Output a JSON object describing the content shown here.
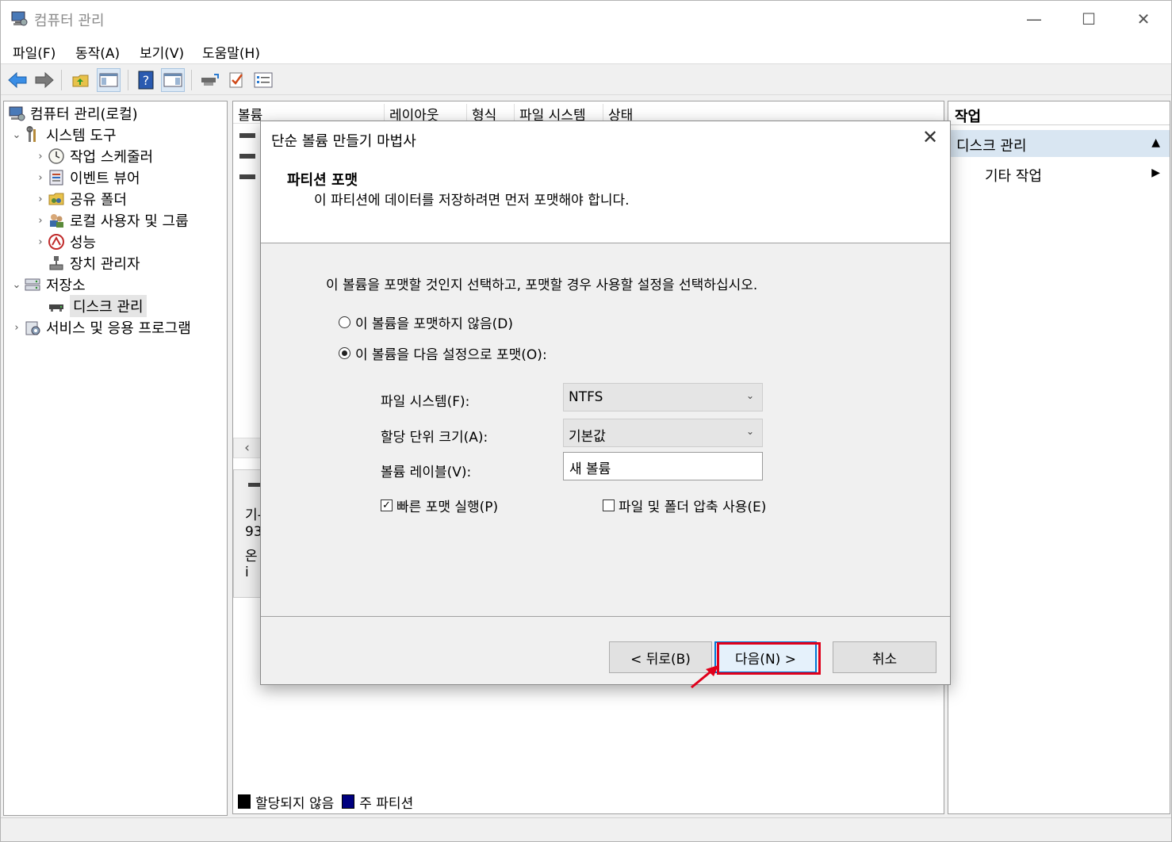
{
  "window": {
    "title": "컴퓨터 관리",
    "minimize_glyph": "—",
    "maximize_glyph": "☐",
    "close_glyph": "✕"
  },
  "menu": [
    "파일(F)",
    "동작(A)",
    "보기(V)",
    "도움말(H)"
  ],
  "toolbar_icons": [
    "back-arrow-icon",
    "forward-arrow-icon",
    "up-folder-icon",
    "show-hide-console-tree-icon",
    "help-icon",
    "show-hide-action-pane-icon",
    "connect-icon",
    "check-icon",
    "properties-list-icon"
  ],
  "tree": {
    "root": "컴퓨터 관리(로컬)",
    "system_tools": "시스템 도구",
    "task_scheduler": "작업 스케줄러",
    "event_viewer": "이벤트 뷰어",
    "shared_folders": "공유 폴더",
    "local_users": "로컬 사용자 및 그룹",
    "performance": "성능",
    "device_manager": "장치 관리자",
    "storage": "저장소",
    "disk_management": "디스크 관리",
    "services_apps": "서비스 및 응용 프로그램",
    "expand_glyph": "›",
    "collapse_glyph": "⌄"
  },
  "center": {
    "columns": [
      "볼륨",
      "레이아웃",
      "형식",
      "파일 시스템",
      "상태"
    ],
    "disk_info_fragments": [
      "기-",
      "93",
      "온i"
    ],
    "scroll_left_glyph": "‹",
    "legend": [
      {
        "label": "할당되지 않음",
        "color": "#000000"
      },
      {
        "label": "주 파티션",
        "color": "#00007f"
      }
    ]
  },
  "actions": {
    "title": "작업",
    "section": "디스크 관리",
    "more": "기타 작업",
    "collapse_glyph": "▲",
    "more_glyph": "▶"
  },
  "dialog": {
    "title": "단순 볼륨 만들기 마법사",
    "close_glyph": "✕",
    "section_title": "파티션 포맷",
    "section_subtitle": "이 파티션에 데이터를 저장하려면 먼저 포맷해야 합니다.",
    "instruction": "이 볼륨을 포맷할 것인지 선택하고, 포맷할 경우 사용할 설정을 선택하십시오.",
    "radio_no_format": "이 볼륨을 포맷하지 않음(D)",
    "radio_format": "이 볼륨을 다음 설정으로 포맷(O):",
    "radio_selected": "format",
    "fs_label": "파일 시스템(F):",
    "fs_value": "NTFS",
    "alloc_label": "할당 단위 크기(A):",
    "alloc_value": "기본값",
    "volume_label_label": "볼륨 레이블(V):",
    "volume_label_value": "새 볼륨",
    "quick_format": "빠른 포맷 실행(P)",
    "quick_format_checked": true,
    "compression": "파일 및 폴더 압축 사용(E)",
    "compression_checked": false,
    "check_glyph": "✓",
    "combo_arrow_glyph": "⌄",
    "back_button": "< 뒤로(B)",
    "next_button": "다음(N) >",
    "cancel_button": "취소"
  },
  "colors": {
    "highlight": "#e0001b",
    "selection_bg": "#d9e6f2",
    "default_button_border": "#0078d7"
  }
}
